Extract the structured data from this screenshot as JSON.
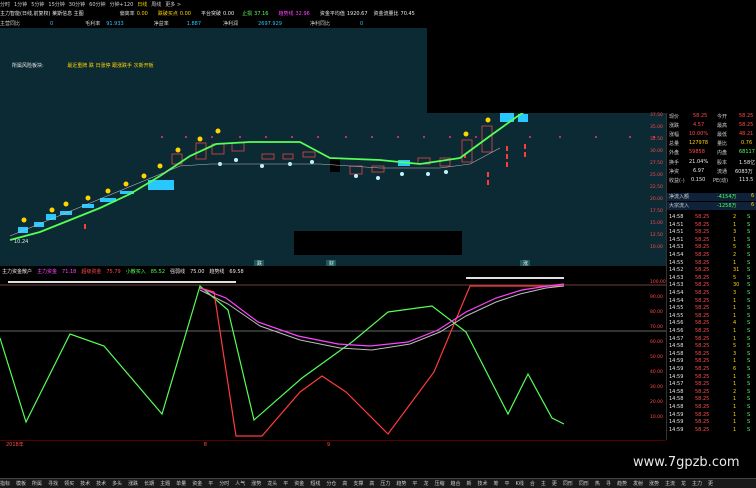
{
  "periods": [
    "分时",
    "1分钟",
    "5分钟",
    "15分钟",
    "30分钟",
    "60分钟",
    "日线",
    "周线",
    "更多 >"
  ],
  "periods_extra": "分钟+120",
  "info1": {
    "title": "主力智能(日线,前复权)  莱斯信息 主图",
    "l1": "偏离率",
    "v1": "0.00",
    "l2": "跌破买点",
    "v2": "0.00",
    "l3": "平台突破",
    "v3": "0.00",
    "l4": "止损",
    "v4": "37.16",
    "l5": "趋势线",
    "v5": "32.96",
    "l6": "资金平均值",
    "v6": "1920.67",
    "l7": "资金流量比",
    "v7": "70.45"
  },
  "info2": {
    "l1": "主营同比",
    "v1": "0",
    "l2": "毛利率",
    "v2": "91.933",
    "l3": "净益率",
    "v3": "1.887",
    "l4": "净利润",
    "v4": "2697.929",
    "l5": "净利同比",
    "v5": "0"
  },
  "chart1_note": {
    "label": "所属风险板块:",
    "value": "最近重牌 跌 日涨停 跟涨跌手 次新开板"
  },
  "chart1_low_label": "10.24",
  "chart1_markers": [
    "跌",
    "财",
    "涨"
  ],
  "indicator": {
    "title": "主力资金散户",
    "l1": "主力资金",
    "v1": "71.18",
    "l2": "超级资金",
    "v2": "75.79",
    "l3": "小散买入",
    "v3": "85.52",
    "l4": "强弱线",
    "v4": "75.00",
    "l5": "趋势线",
    "v5": "69.58"
  },
  "right_axis_top": [
    "37.50",
    "35.00",
    "32.50",
    "30.00",
    "27.50",
    "25.00",
    "22.50",
    "20.00",
    "17.50",
    "15.00",
    "12.50",
    "10.00"
  ],
  "right_axis_bottom": [
    "100.00",
    "90.00",
    "80.00",
    "70.00",
    "60.00",
    "50.00",
    "40.00",
    "30.00",
    "20.00",
    "10.00"
  ],
  "quote": {
    "rows": [
      {
        "l1": "现价",
        "v1": "58.25",
        "l2": "今开",
        "v2": "58.25"
      },
      {
        "l1": "涨跌",
        "v1": "4.57",
        "l2": "最高",
        "v2": "58.25"
      },
      {
        "l1": "涨幅",
        "v1": "10.00%",
        "l2": "最低",
        "v2": "48.21"
      },
      {
        "l1": "总量",
        "v1": "127978",
        "l2": "量比",
        "v2": "0.76"
      },
      {
        "l1": "外盘",
        "v1": "59858",
        "l2": "内盘",
        "v2": "68117"
      },
      {
        "l1": "换手",
        "v1": "21.04%",
        "l2": "股本",
        "v2": "1.58亿"
      },
      {
        "l1": "净资",
        "v1": "6.97",
        "l2": "流通",
        "v2": "6083万"
      },
      {
        "l1": "收益(-)",
        "v1": "0.150",
        "l2": "PE(动)",
        "v2": "113.5"
      }
    ],
    "inflow1": {
      "label": "净流入额",
      "value": "-4154万",
      "tag": "6"
    },
    "inflow2": {
      "label": "大宗流入",
      "value": "-1258万",
      "tag": "6"
    }
  },
  "ticks": [
    {
      "t": "14:58",
      "p": "58.25",
      "v": "2",
      "d": "S"
    },
    {
      "t": "14:51",
      "p": "58.25",
      "v": "1",
      "d": "S"
    },
    {
      "t": "14:51",
      "p": "58.25",
      "v": "3",
      "d": "S"
    },
    {
      "t": "14:51",
      "p": "58.25",
      "v": "1",
      "d": "S"
    },
    {
      "t": "14:53",
      "p": "58.25",
      "v": "5",
      "d": "S"
    },
    {
      "t": "14:54",
      "p": "58.25",
      "v": "2",
      "d": "S"
    },
    {
      "t": "14:55",
      "p": "58.25",
      "v": "1",
      "d": "S"
    },
    {
      "t": "14:52",
      "p": "58.25",
      "v": "31",
      "d": "S"
    },
    {
      "t": "14:53",
      "p": "58.25",
      "v": "5",
      "d": "S"
    },
    {
      "t": "14:53",
      "p": "58.25",
      "v": "30",
      "d": "S"
    },
    {
      "t": "14:54",
      "p": "58.25",
      "v": "3",
      "d": "S"
    },
    {
      "t": "14:54",
      "p": "58.25",
      "v": "1",
      "d": "S"
    },
    {
      "t": "14:55",
      "p": "58.25",
      "v": "1",
      "d": "S"
    },
    {
      "t": "14:55",
      "p": "58.25",
      "v": "1",
      "d": "S"
    },
    {
      "t": "14:56",
      "p": "58.25",
      "v": "4",
      "d": "S"
    },
    {
      "t": "14:56",
      "p": "58.25",
      "v": "1",
      "d": "S"
    },
    {
      "t": "14:57",
      "p": "58.25",
      "v": "1",
      "d": "S"
    },
    {
      "t": "14:58",
      "p": "58.25",
      "v": "5",
      "d": "S"
    },
    {
      "t": "14:58",
      "p": "58.25",
      "v": "3",
      "d": "S"
    },
    {
      "t": "14:59",
      "p": "58.25",
      "v": "1",
      "d": "S"
    },
    {
      "t": "14:59",
      "p": "58.25",
      "v": "6",
      "d": "S"
    },
    {
      "t": "14:59",
      "p": "58.25",
      "v": "1",
      "d": "S"
    },
    {
      "t": "14:57",
      "p": "58.25",
      "v": "1",
      "d": "S"
    },
    {
      "t": "14:58",
      "p": "58.25",
      "v": "2",
      "d": "S"
    },
    {
      "t": "14:58",
      "p": "58.25",
      "v": "1",
      "d": "S"
    },
    {
      "t": "14:58",
      "p": "58.25",
      "v": "1",
      "d": "S"
    },
    {
      "t": "14:59",
      "p": "58.25",
      "v": "1",
      "d": "S"
    },
    {
      "t": "14:59",
      "p": "58.25",
      "v": "1",
      "d": "S"
    },
    {
      "t": "14:59",
      "p": "58.25",
      "v": "1",
      "d": "S"
    }
  ],
  "year_labels": [
    "2018年",
    "8",
    "9"
  ],
  "watermark": "www.7gpzb.com",
  "tabs": [
    "指标",
    "模板",
    "所属",
    "寻找",
    "领买",
    "技术",
    "技术",
    "多头",
    "涨跌",
    "长期",
    "主题",
    "单量",
    "资金",
    "平",
    "分时",
    "人气",
    "涨势",
    "龙头",
    "平",
    "资金",
    "短线",
    "分仓",
    "高",
    "支撑",
    "高",
    "压力",
    "趋势",
    "平",
    "龙",
    "压缩",
    "趋合",
    "新",
    "技术",
    "筹",
    "平",
    "K线",
    "合",
    "主",
    "更",
    "同形",
    "同形",
    "热",
    "寻",
    "趋势",
    "发射",
    "涨势",
    "主流",
    "龙",
    "主力",
    "更"
  ],
  "colors": {
    "bg_chart": "#0b2a33",
    "green_line": "#55ff55",
    "red_line": "#ff3b3b",
    "magenta_line": "#ff44ff",
    "gray_line": "#bbbbbb",
    "up": "#ff3b3b",
    "down": "#28c8ff"
  }
}
